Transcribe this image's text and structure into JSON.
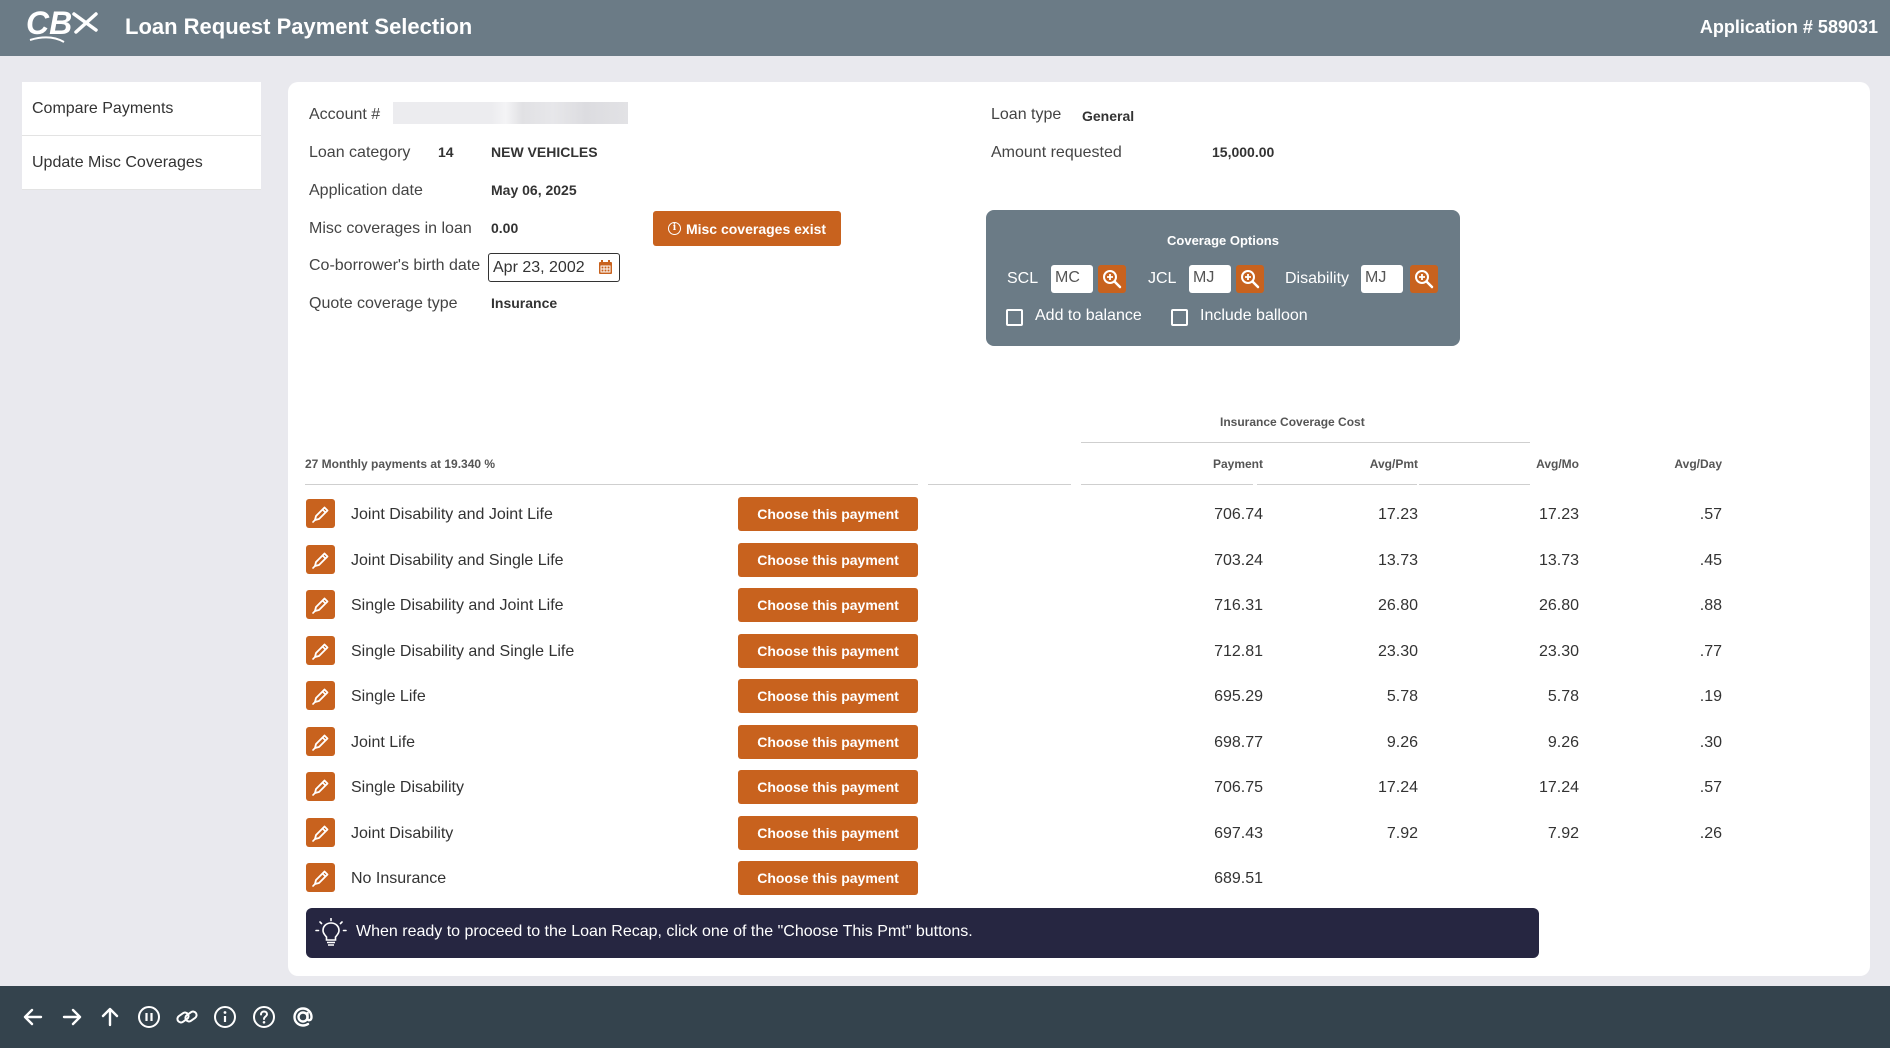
{
  "header": {
    "logo_text": "CBX",
    "title": "Loan Request Payment Selection",
    "application_number": "Application # 589031"
  },
  "sidebar": {
    "items": [
      {
        "label": "Compare Payments"
      },
      {
        "label": "Update Misc Coverages"
      }
    ]
  },
  "loan": {
    "account_label": "Account #",
    "loan_category_label": "Loan category",
    "loan_category_code": "14",
    "loan_category_value": "NEW VEHICLES",
    "application_date_label": "Application date",
    "application_date_value": "May 06, 2025",
    "misc_coverages_label": "Misc coverages in loan",
    "misc_coverages_value": "0.00",
    "misc_button_label": "Misc coverages exist",
    "coborrower_label": "Co-borrower's birth date",
    "coborrower_value": "Apr 23, 2002",
    "quote_type_label": "Quote coverage type",
    "quote_type_value": "Insurance",
    "loan_type_label": "Loan type",
    "loan_type_value": "General",
    "amount_label": "Amount requested",
    "amount_value": "15,000.00"
  },
  "coverage_options": {
    "title": "Coverage Options",
    "scl_label": "SCL",
    "scl_value": "MC",
    "jcl_label": "JCL",
    "jcl_value": "MJ",
    "disability_label": "Disability",
    "disability_value": "MJ",
    "add_to_balance_label": "Add to balance",
    "add_to_balance_checked": false,
    "include_balloon_label": "Include balloon",
    "include_balloon_checked": false
  },
  "table": {
    "group_header": "Insurance Coverage Cost",
    "summary": "27 Monthly payments at 19.340 %",
    "col_payment": "Payment",
    "col_avg_pmt": "Avg/Pmt",
    "col_avg_mo": "Avg/Mo",
    "col_avg_day": "Avg/Day",
    "choose_label": "Choose this payment",
    "rows": [
      {
        "label": "Joint Disability and Joint Life",
        "payment": "706.74",
        "avg_pmt": "17.23",
        "avg_mo": "17.23",
        "avg_day": ".57"
      },
      {
        "label": "Joint Disability and Single Life",
        "payment": "703.24",
        "avg_pmt": "13.73",
        "avg_mo": "13.73",
        "avg_day": ".45"
      },
      {
        "label": "Single Disability and Joint Life",
        "payment": "716.31",
        "avg_pmt": "26.80",
        "avg_mo": "26.80",
        "avg_day": ".88"
      },
      {
        "label": "Single Disability and Single Life",
        "payment": "712.81",
        "avg_pmt": "23.30",
        "avg_mo": "23.30",
        "avg_day": ".77"
      },
      {
        "label": "Single Life",
        "payment": "695.29",
        "avg_pmt": "5.78",
        "avg_mo": "5.78",
        "avg_day": ".19"
      },
      {
        "label": "Joint Life",
        "payment": "698.77",
        "avg_pmt": "9.26",
        "avg_mo": "9.26",
        "avg_day": ".30"
      },
      {
        "label": "Single Disability",
        "payment": "706.75",
        "avg_pmt": "17.24",
        "avg_mo": "17.24",
        "avg_day": ".57"
      },
      {
        "label": "Joint Disability",
        "payment": "697.43",
        "avg_pmt": "7.92",
        "avg_mo": "7.92",
        "avg_day": ".26"
      },
      {
        "label": "No Insurance",
        "payment": "689.51",
        "avg_pmt": "",
        "avg_mo": "",
        "avg_day": ""
      }
    ]
  },
  "tip": {
    "text": "When ready to proceed to the Loan Recap, click one of the \"Choose This Pmt\" buttons."
  },
  "bottom_toolbar": {
    "icons": [
      "back-arrow-icon",
      "forward-arrow-icon",
      "up-arrow-icon",
      "pause-icon",
      "link-icon",
      "info-icon",
      "help-icon",
      "at-sign-icon"
    ]
  },
  "colors": {
    "header_bg": "#6b7b86",
    "accent": "#c8621e",
    "tip_bg": "#262641",
    "bottom_bar": "#34434d"
  }
}
